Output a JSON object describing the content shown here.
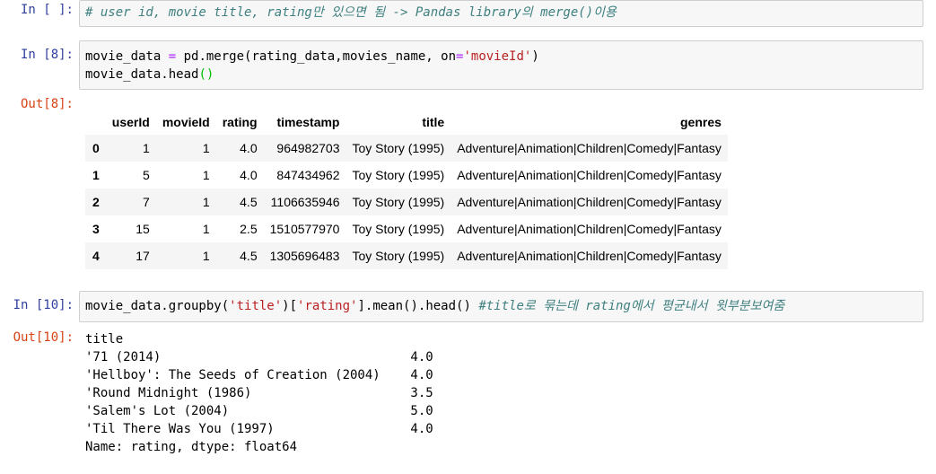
{
  "cells": {
    "c1": {
      "prompt": "In [ ]:",
      "comment": "# user id, movie title, rating만 있으면 됨 -> Pandas library의 merge()이용"
    },
    "c2": {
      "prompt": "In [8]:",
      "line1_a": "movie_data ",
      "line1_eq": "=",
      "line1_b": " pd.merge(rating_data,movies_name, on",
      "line1_eq2": "=",
      "line1_str": "'movieId'",
      "line1_c": ")",
      "line2_a": "movie_data.head",
      "line2_paren": "()"
    },
    "o2": {
      "prompt": "Out[8]:",
      "columns": [
        "",
        "userId",
        "movieId",
        "rating",
        "timestamp",
        "title",
        "genres"
      ],
      "rows": [
        [
          "0",
          "1",
          "1",
          "4.0",
          "964982703",
          "Toy Story (1995)",
          "Adventure|Animation|Children|Comedy|Fantasy"
        ],
        [
          "1",
          "5",
          "1",
          "4.0",
          "847434962",
          "Toy Story (1995)",
          "Adventure|Animation|Children|Comedy|Fantasy"
        ],
        [
          "2",
          "7",
          "1",
          "4.5",
          "1106635946",
          "Toy Story (1995)",
          "Adventure|Animation|Children|Comedy|Fantasy"
        ],
        [
          "3",
          "15",
          "1",
          "2.5",
          "1510577970",
          "Toy Story (1995)",
          "Adventure|Animation|Children|Comedy|Fantasy"
        ],
        [
          "4",
          "17",
          "1",
          "4.5",
          "1305696483",
          "Toy Story (1995)",
          "Adventure|Animation|Children|Comedy|Fantasy"
        ]
      ]
    },
    "c3": {
      "prompt": "In [10]:",
      "code_a": "movie_data.groupby(",
      "str1": "'title'",
      "code_b": ")[",
      "str2": "'rating'",
      "code_c": "].mean().head() ",
      "comment": "#title로 묶는데 rating에서 평균내서 윗부분보여줌"
    },
    "o3": {
      "prompt": "Out[10]:",
      "lines": [
        "title",
        "'71 (2014)                                 4.0",
        "'Hellboy': The Seeds of Creation (2004)    4.0",
        "'Round Midnight (1986)                     3.5",
        "'Salem's Lot (2004)                        5.0",
        "'Til There Was You (1997)                  4.0",
        "Name: rating, dtype: float64"
      ]
    }
  }
}
